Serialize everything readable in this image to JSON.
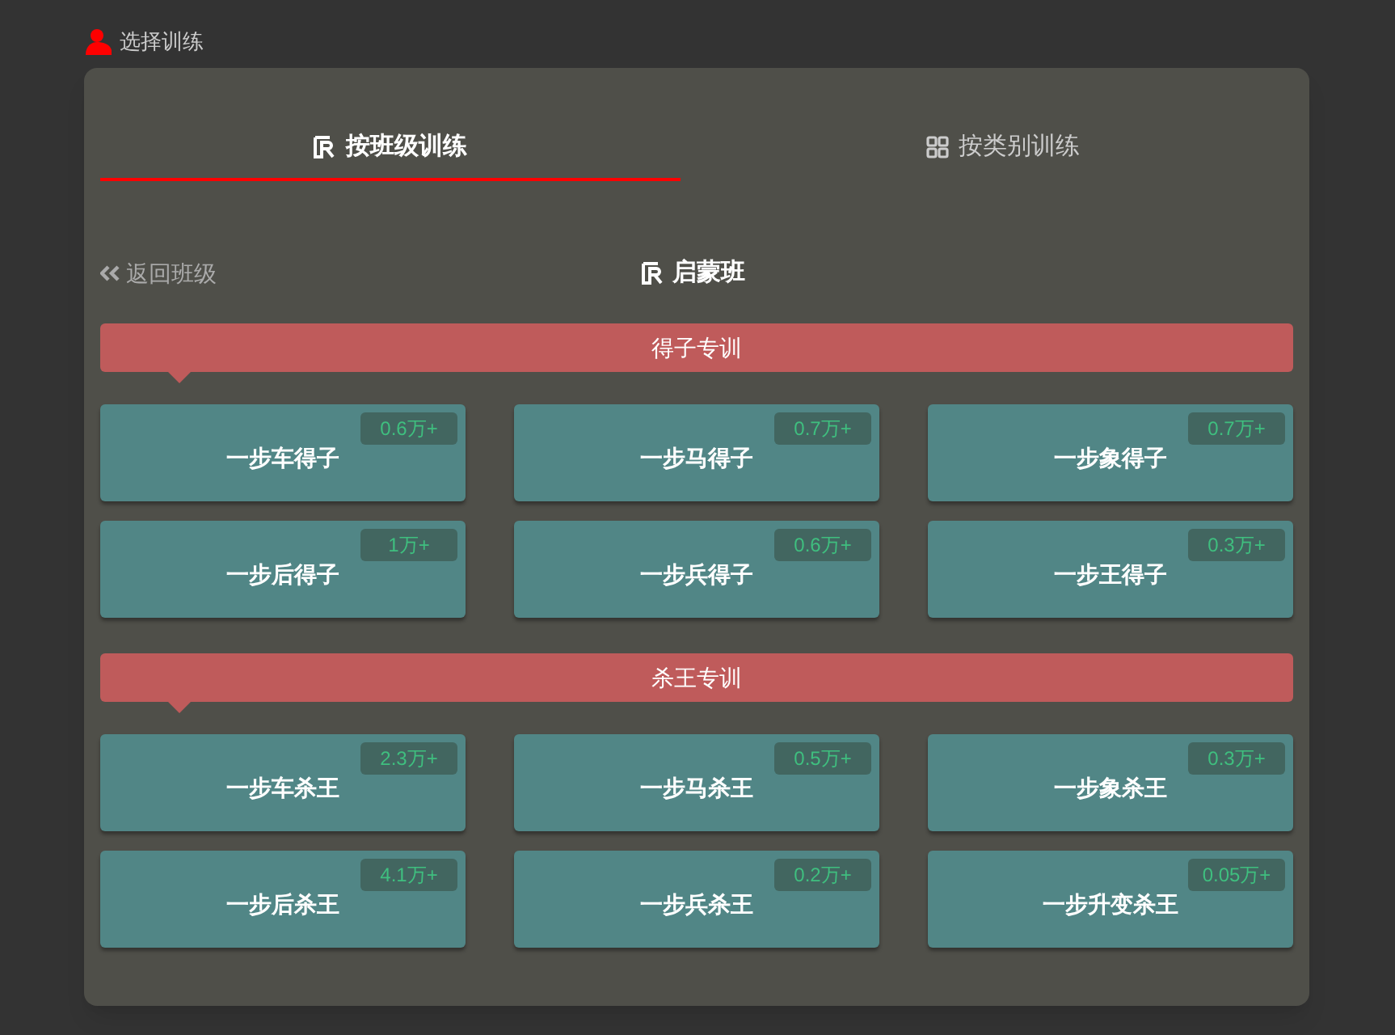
{
  "header": {
    "title": "选择训练"
  },
  "tabs": [
    {
      "label": "按班级训练",
      "selected": true,
      "kind": "class"
    },
    {
      "label": "按类别训练",
      "selected": false,
      "kind": "category"
    }
  ],
  "nav": {
    "back": "返回班级",
    "title": "启蒙班"
  },
  "sections": [
    {
      "title": "得子专训",
      "items": [
        {
          "label": "一步车得子",
          "count": "0.6万+"
        },
        {
          "label": "一步马得子",
          "count": "0.7万+"
        },
        {
          "label": "一步象得子",
          "count": "0.7万+"
        },
        {
          "label": "一步后得子",
          "count": "1万+"
        },
        {
          "label": "一步兵得子",
          "count": "0.6万+"
        },
        {
          "label": "一步王得子",
          "count": "0.3万+"
        }
      ]
    },
    {
      "title": "杀王专训",
      "items": [
        {
          "label": "一步车杀王",
          "count": "2.3万+"
        },
        {
          "label": "一步马杀王",
          "count": "0.5万+"
        },
        {
          "label": "一步象杀王",
          "count": "0.3万+"
        },
        {
          "label": "一步后杀王",
          "count": "4.1万+"
        },
        {
          "label": "一步兵杀王",
          "count": "0.2万+"
        },
        {
          "label": "一步升变杀王",
          "count": "0.05万+"
        }
      ]
    }
  ]
}
